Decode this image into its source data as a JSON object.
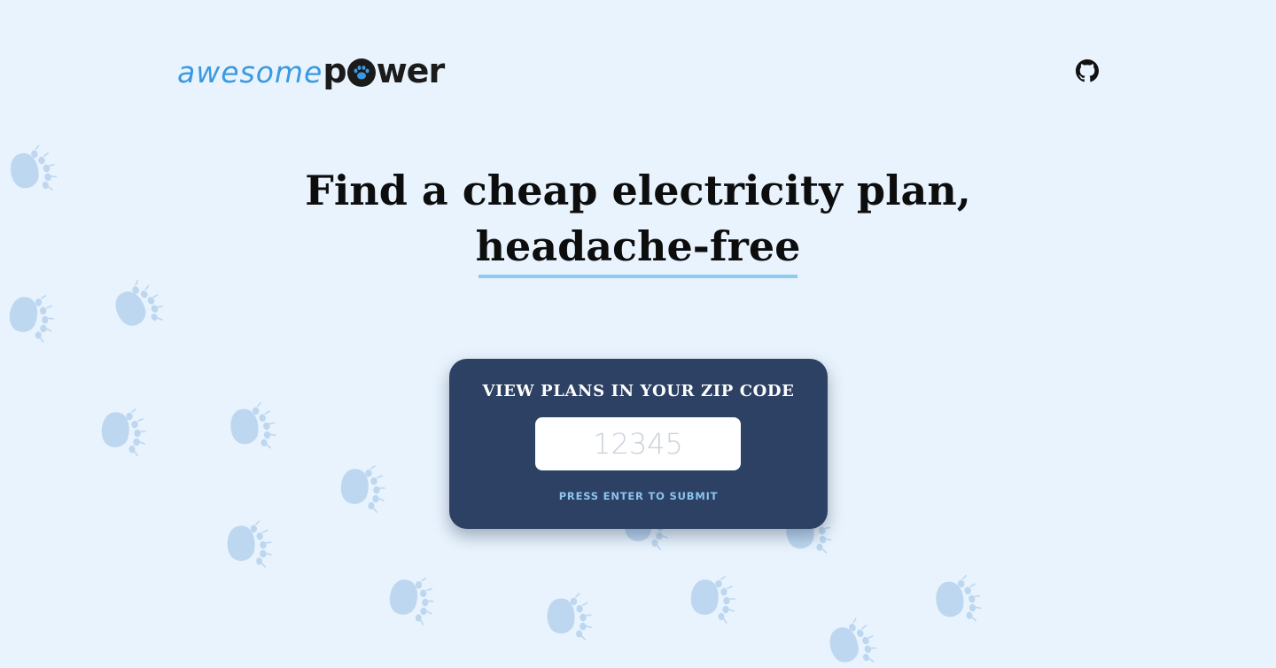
{
  "logo": {
    "part1": "awesome",
    "part2_prefix": "p",
    "part2_suffix": "wer",
    "accent_color": "#3a99e0"
  },
  "header": {
    "github_icon": "github-icon"
  },
  "hero": {
    "line1": "Find a cheap electricity plan,",
    "line2": "headache-free",
    "underline_color": "#8cccf0"
  },
  "zip_form": {
    "title": "VIEW PLANS IN YOUR ZIP CODE",
    "placeholder": "12345",
    "value": "",
    "hint": "PRESS ENTER TO SUBMIT",
    "card_color": "#2c4163"
  },
  "background": {
    "color": "#e8f3fd",
    "decoration_icon": "paw-print-icon",
    "paw_color": "#b6d3ee"
  }
}
